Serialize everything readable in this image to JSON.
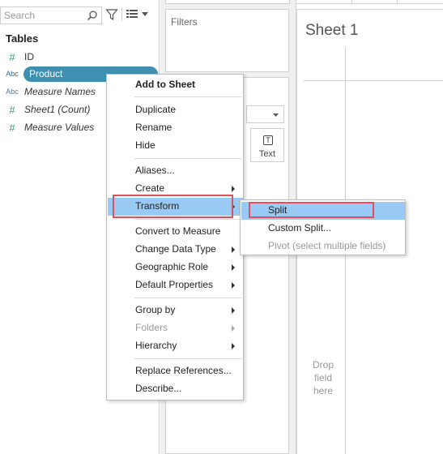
{
  "data_pane": {
    "search_placeholder": "Search",
    "tables_title": "Tables",
    "fields": [
      {
        "type": "#",
        "label": "ID"
      },
      {
        "type": "Abc",
        "label": "Product"
      },
      {
        "type": "Abc",
        "label": "Measure Names"
      },
      {
        "type": "#",
        "label": "Sheet1 (Count)"
      },
      {
        "type": "#",
        "label": "Measure Values"
      }
    ]
  },
  "shelves": {
    "filters_title": "Filters",
    "text_button_glyph": "T",
    "text_button_label": "Text"
  },
  "sheet": {
    "title": "Sheet 1",
    "drop_text": "Drop field here"
  },
  "context_menu": {
    "items": [
      {
        "label": "Add to Sheet"
      },
      {
        "label": "Duplicate"
      },
      {
        "label": "Rename"
      },
      {
        "label": "Hide"
      },
      {
        "label": "Aliases..."
      },
      {
        "label": "Create"
      },
      {
        "label": "Transform"
      },
      {
        "label": "Convert to Measure"
      },
      {
        "label": "Change Data Type"
      },
      {
        "label": "Geographic Role"
      },
      {
        "label": "Default Properties"
      },
      {
        "label": "Group by"
      },
      {
        "label": "Folders"
      },
      {
        "label": "Hierarchy"
      },
      {
        "label": "Replace References..."
      },
      {
        "label": "Describe..."
      }
    ]
  },
  "transform_submenu": {
    "items": [
      {
        "label": "Split"
      },
      {
        "label": "Custom Split..."
      },
      {
        "label": "Pivot (select multiple fields)"
      }
    ]
  },
  "colors": {
    "selected_pill": "#3f8fb0",
    "menu_hover": "#99c9f5",
    "highlight_box": "#e0505a",
    "measure_icon": "#3a9b7a",
    "dimension_icon": "#4a7fa8"
  }
}
